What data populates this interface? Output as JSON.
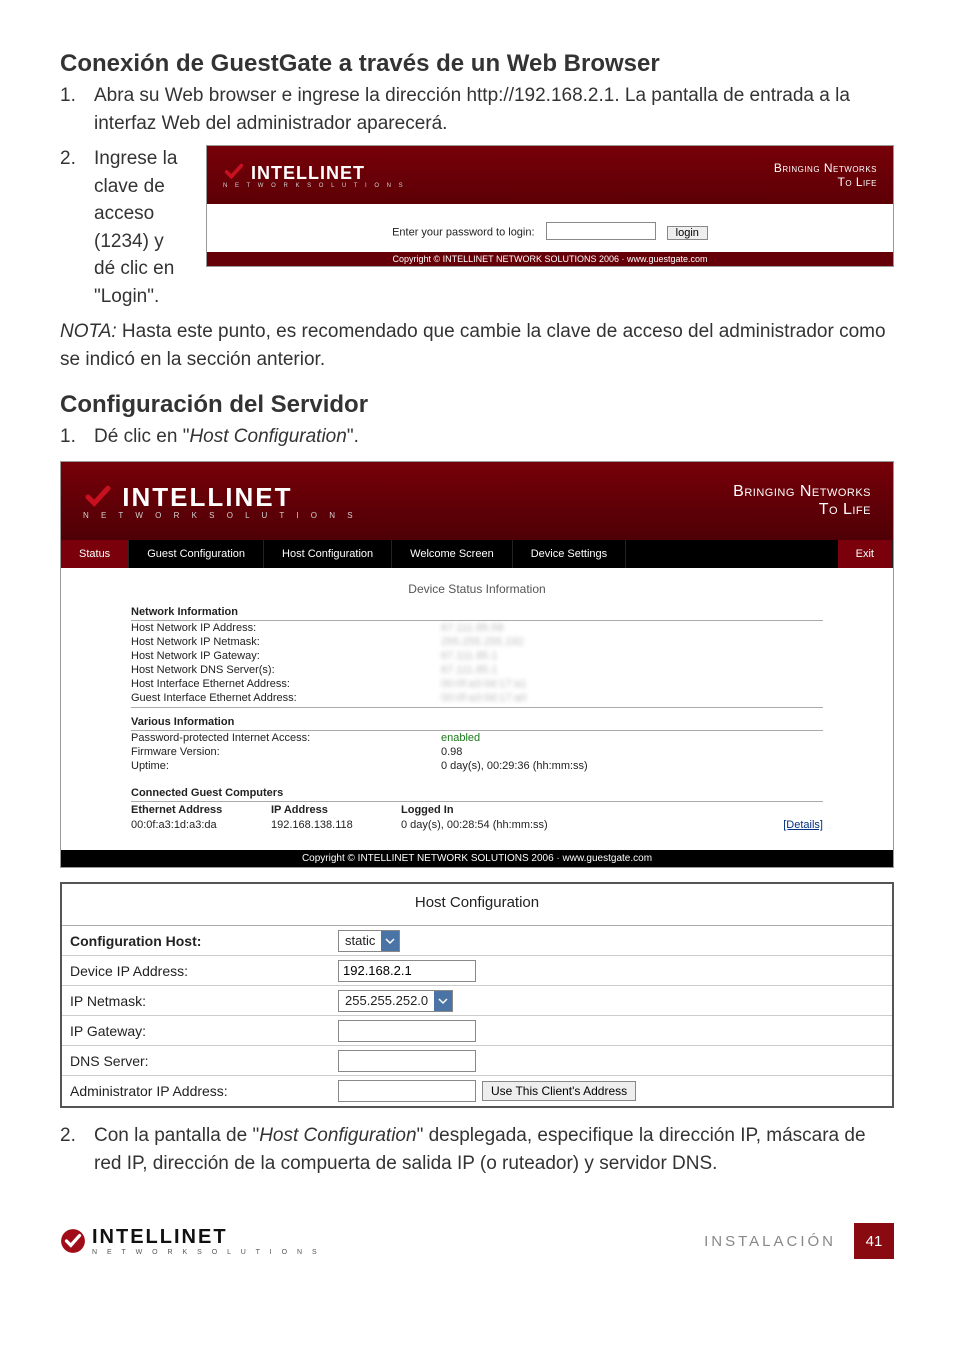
{
  "heading1": "Conexión de GuestGate a través de un Web Browser",
  "step1_num": "1.",
  "step1_text": "Abra su Web browser e ingrese la dirección http://192.168.2.1. La pantalla de entrada a la interfaz Web del administrador aparecerá.",
  "step2_num": "2.",
  "step2_text": "Ingrese la clave de acceso (1234) y dé clic en \"Login\".",
  "login_shot": {
    "brand": "INTELLINET",
    "brand_sub": "N E T W O R K   S O L U T I O N S",
    "slogan1": "Bringing Networks",
    "slogan2": "To Life",
    "prompt": "Enter your password to login:",
    "login_btn": "login",
    "copyright": "Copyright © INTELLINET NETWORK SOLUTIONS 2006 · www.guestgate.com"
  },
  "note_label": "NOTA:",
  "note_text": " Hasta este punto, es recomendado que cambie la clave de acceso del administrador como se indicó en la sección anterior.",
  "heading2": "Configuración del Servidor",
  "svr_step1_num": "1.",
  "svr_step1_a": "Dé clic en \"",
  "svr_step1_italic": "Host Configuration",
  "svr_step1_b": "\".",
  "tabs": {
    "status": "Status",
    "guest": "Guest Configuration",
    "host": "Host Configuration",
    "welcome": "Welcome Screen",
    "device": "Device Settings",
    "exit": "Exit"
  },
  "panel": {
    "title": "Device Status Information",
    "netinfo_head": "Network Information",
    "rows": {
      "ip_addr": "Host Network IP Address:",
      "ip_addr_v": "67.111.85.58",
      "netmask": "Host Network IP Netmask:",
      "netmask_v": "255.255.255.192",
      "gateway": "Host Network IP Gateway:",
      "gateway_v": "67.111.85.1",
      "dns": "Host Network DNS Server(s):",
      "dns_v": "67.111.85.1",
      "hosteth": "Host Interface Ethernet Address:",
      "hosteth_v": "00:0f:a3:0d:17:a1",
      "guesteth": "Guest Interface Ethernet Address:",
      "guesteth_v": "00:0f:a3:0d:17:a0"
    },
    "varinfo_head": "Various Information",
    "var": {
      "pwd": "Password-protected Internet Access:",
      "pwd_v": "enabled",
      "fw": "Firmware Version:",
      "fw_v": "0.98",
      "up": "Uptime:",
      "up_v": "0 day(s), 00:29:36 (hh:mm:ss)"
    },
    "guests_head": "Connected Guest Computers",
    "gcols": {
      "eth": "Ethernet Address",
      "ip": "IP Address",
      "logged": "Logged In"
    },
    "grow": {
      "eth": "00:0f:a3:1d:a3:da",
      "ip": "192.168.138.118",
      "logged": "0 day(s), 00:28:54 (hh:mm:ss)",
      "details": "[Details]"
    }
  },
  "copyright2": "Copyright © INTELLINET NETWORK SOLUTIONS 2006 · www.guestgate.com",
  "hostcfg": {
    "title": "Host Configuration",
    "cfg_host": "Configuration Host:",
    "cfg_host_v": "static",
    "dev_ip": "Device IP Address:",
    "dev_ip_v": "192.168.2.1",
    "netmask": "IP Netmask:",
    "netmask_v": "255.255.252.0",
    "gateway": "IP Gateway:",
    "gateway_v": "",
    "dns": "DNS Server:",
    "dns_v": "",
    "admin_ip": "Administrator IP Address:",
    "admin_ip_v": "",
    "use_btn": "Use This Client's Address"
  },
  "svr_step2_num": "2.",
  "svr_step2_a": "Con la pantalla de \"",
  "svr_step2_italic": "Host Configuration",
  "svr_step2_b": "\" desplegada, especifique la dirección IP, máscara de red IP, dirección de la compuerta de salida IP (o ruteador) y servidor DNS.",
  "footer": {
    "brand": "INTELLINET",
    "brand_sub": "N E T W O R K   S O L U T I O N S",
    "section": "INSTALACIÓN",
    "page": "41"
  }
}
